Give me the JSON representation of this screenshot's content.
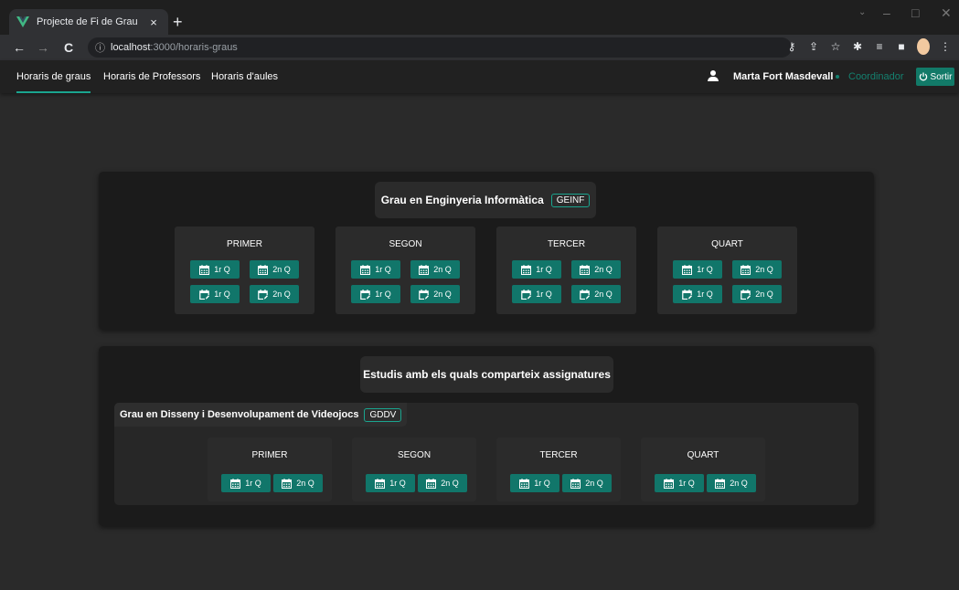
{
  "browser": {
    "tab_title": "Projecte de Fi de Grau",
    "tab_close": "×",
    "new_tab": "+",
    "url_host": "localhost",
    "url_path": ":3000/horaris-graus"
  },
  "app": {
    "nav_tabs": [
      "Horaris de graus",
      "Horaris de Professors",
      "Horaris d'aules"
    ],
    "active_tab": "Horaris de graus",
    "user_name": "Marta Fort Masdevall",
    "user_role": "Coordinador",
    "logout_label": "Sortir",
    "accent_color": "#1aa58f"
  },
  "main_degree": {
    "name": "Grau en Enginyeria Informàtica",
    "code": "GEINF",
    "years": [
      {
        "label": "PRIMER",
        "q1": "1r Q",
        "q2": "2n Q"
      },
      {
        "label": "SEGON",
        "q1": "1r Q",
        "q2": "2n Q"
      },
      {
        "label": "TERCER",
        "q1": "1r Q",
        "q2": "2n Q"
      },
      {
        "label": "QUART",
        "q1": "1r Q",
        "q2": "2n Q"
      }
    ]
  },
  "shared": {
    "title": "Estudis amb els quals comparteix assignatures",
    "degree_name": "Grau en Disseny i Desenvolupament de Videojocs",
    "degree_code": "GDDV",
    "years": [
      {
        "label": "PRIMER",
        "q1": "1r Q",
        "q2": "2n Q"
      },
      {
        "label": "SEGON",
        "q1": "1r Q",
        "q2": "2n Q"
      },
      {
        "label": "TERCER",
        "q1": "1r Q",
        "q2": "2n Q"
      },
      {
        "label": "QUART",
        "q1": "1r Q",
        "q2": "2n Q"
      }
    ]
  }
}
